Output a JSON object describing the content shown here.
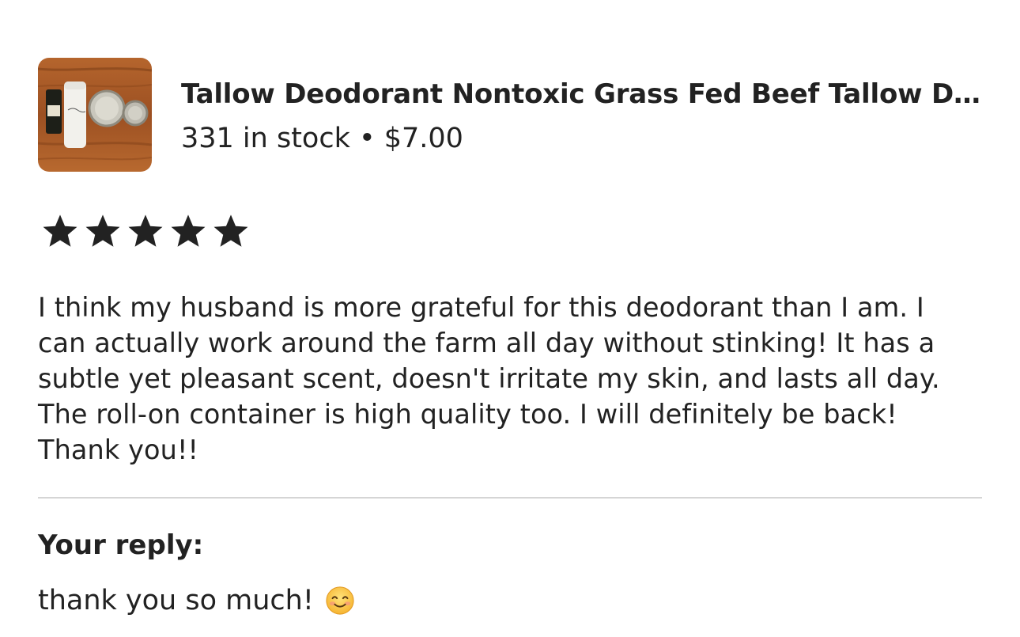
{
  "product": {
    "title": "Tallow Deodorant Nontoxic Grass Fed Beef Tallow D...",
    "meta": "331 in stock • $7.00",
    "thumbnail_icon": "product-thumbnail"
  },
  "review": {
    "rating": 5,
    "rating_max": 5,
    "star_color": "#222222",
    "text": "I think my husband is more grateful for this deodorant than I am. I can actually work around the farm all day without stinking! It has a subtle yet pleasant scent, doesn't irritate my skin, and lasts all day. The roll-on container is high quality too. I will definitely be back! Thank you!!"
  },
  "reply": {
    "heading": "Your reply:",
    "text": "thank you so much!",
    "emoji_icon": "smiling-face-emoji"
  }
}
